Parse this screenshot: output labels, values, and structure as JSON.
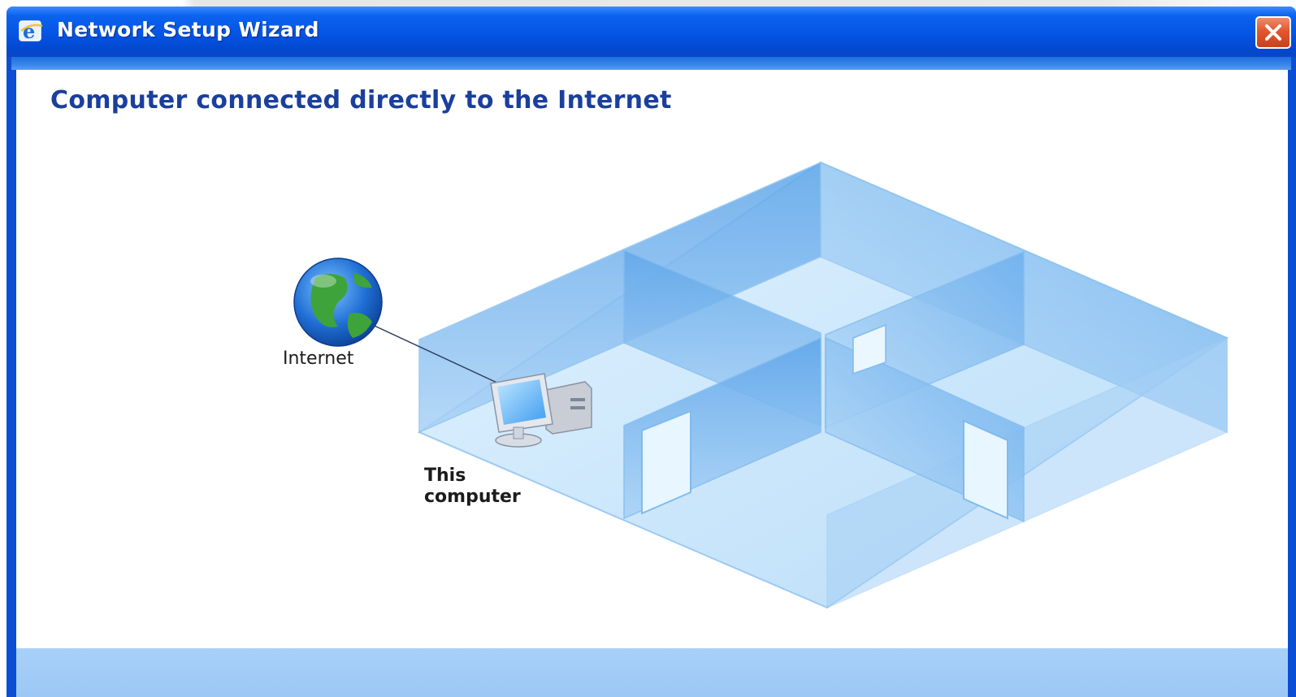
{
  "window": {
    "title": "Network Setup Wizard",
    "icons": {
      "title_icon": "internet-explorer-icon",
      "close": "close-icon"
    }
  },
  "page": {
    "heading": "Computer connected directly to the Internet"
  },
  "diagram": {
    "internet_label": "Internet",
    "computer_label_line1": "This",
    "computer_label_line2": "computer",
    "icons": {
      "globe": "globe-icon",
      "computer": "computer-icon"
    }
  },
  "colors": {
    "titlebar": "#0554e3",
    "close_button": "#e3562f",
    "heading": "#1a3f9c",
    "footer": "#a8d0f8",
    "room_floor": "#cfe8fb",
    "room_wall": "#7cb8ee"
  }
}
